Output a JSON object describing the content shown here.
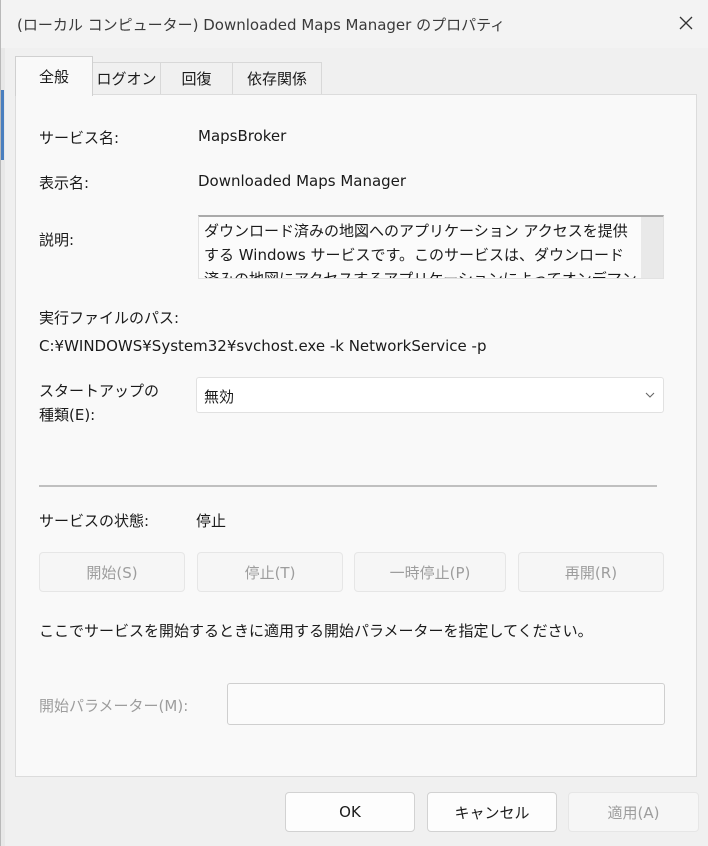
{
  "window": {
    "title": "(ローカル コンピューター) Downloaded Maps Manager のプロパティ"
  },
  "tabs": [
    {
      "label": "全般",
      "active": true
    },
    {
      "label": "ログオン",
      "active": false
    },
    {
      "label": "回復",
      "active": false
    },
    {
      "label": "依存関係",
      "active": false
    }
  ],
  "general": {
    "service_name_label": "サービス名:",
    "service_name": "MapsBroker",
    "display_name_label": "表示名:",
    "display_name": "Downloaded Maps Manager",
    "description_label": "説明:",
    "description": "ダウンロード済みの地図へのアプリケーション アクセスを提供する Windows サービスです。このサービスは、ダウンロード済みの地図にアクセスするアプリケーションによってオンデマンドで開始され",
    "exe_path_label": "実行ファイルのパス:",
    "exe_path": "C:¥WINDOWS¥System32¥svchost.exe -k NetworkService -p",
    "startup_type_label_line1": "スタートアップの",
    "startup_type_label_line2": "種類(E):",
    "startup_type_value": "無効",
    "status_label": "サービスの状態:",
    "status_value": "停止",
    "buttons": {
      "start": "開始(S)",
      "stop": "停止(T)",
      "pause": "一時停止(P)",
      "resume": "再開(R)"
    },
    "hint_text": "ここでサービスを開始するときに適用する開始パラメーターを指定してください。",
    "start_params_label": "開始パラメーター(M):",
    "start_params_value": ""
  },
  "footer": {
    "ok": "OK",
    "cancel": "キャンセル",
    "apply": "適用(A)"
  },
  "colors": {
    "enabled_text": "#1a1a1a",
    "disabled_text": "#9d9d9d",
    "accent_strip": "#4a7fbf"
  },
  "icons": {
    "close": "close-icon",
    "dropdown": "chevron-down-icon"
  }
}
